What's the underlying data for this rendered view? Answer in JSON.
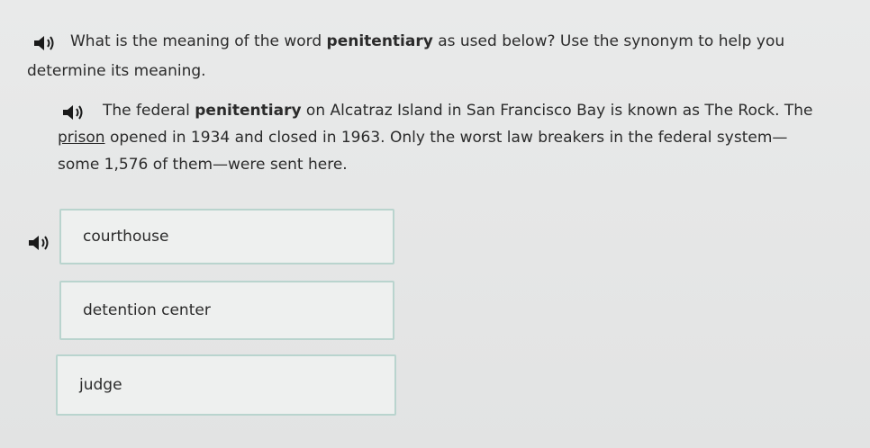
{
  "question": {
    "prefix": "What is the meaning of the word ",
    "keyword": "penitentiary",
    "suffix": " as used below? Use the synonym to help you determine its meaning."
  },
  "passage": {
    "part1": "The federal ",
    "keyword": "penitentiary",
    "part2": " on Alcatraz Island in San Francisco Bay is known as The Rock. The ",
    "underlined": "prison",
    "part3": " opened in 1934 and closed in 1963. Only the worst law breakers in the federal system—some 1,576 of them—were sent here."
  },
  "options": [
    {
      "label": "courthouse"
    },
    {
      "label": "detention center"
    },
    {
      "label": "judge"
    }
  ],
  "icons": {
    "speaker": "speaker-icon"
  },
  "colors": {
    "background": "#e6e7e7",
    "option_border": "#b9d4ce",
    "text": "#2b2b2b"
  }
}
